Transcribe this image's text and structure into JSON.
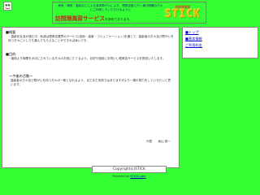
{
  "header": {
    "tagline": "病気・事故・高齢などによる身体障がいにより、理美容室に行く事が困難な方々にご利用していただけるように",
    "brand_name": "訪問理美容サービス",
    "brand_suffix": "を始めております。",
    "logo_sub": "訪問理美容",
    "logo_main": "STICK"
  },
  "main": {
    "section1_head": "■概要",
    "section1_text": "・高齢化社会が進む中、私達は理美容業界のサービス(技術・接客・コミュニケーション)を通じて、高齢者の方々及び障がいを持つ方々に少しでも喜んでもらえることができれば幸いです。",
    "section2_head": "■目的",
    "section2_text": "・普段より時間を大切にされている方々のお役にたてるよう、自宅や施設にお伺いし理美容サービスを提供いたします。",
    "section3_head": "〜今後の活動〜",
    "section3_text": "高齢者の方々及び障がいを持つ方々の一助となれるよう、まだまだ未熟ではありますがより一層の努力をしていきたいと思います。",
    "signature": "代表　　坂山 貴一"
  },
  "sidebar": {
    "items": [
      "■トップ",
      "■基本情報",
      "ご利用料金"
    ]
  },
  "footer": {
    "copyright": "Copyright(c)STICK",
    "powered_prefix": "Powered by",
    "powered_link": "STICK.com"
  }
}
